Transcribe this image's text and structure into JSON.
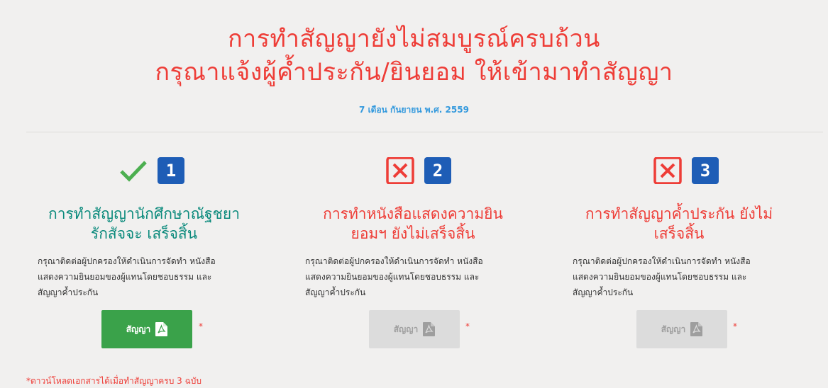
{
  "header": {
    "title_line1": "การทำสัญญายังไม่สมบูรณ์ครบถ้วน",
    "title_line2": "กรุณาแจ้งผู้ค้ำประกัน/ยินยอม ให้เข้ามาทำสัญญา",
    "date": "7 เดือน กันยายน พ.ศ. 2559"
  },
  "steps": [
    {
      "number": "1",
      "status": "complete",
      "status_icon": "check-icon",
      "heading_line1": "การทำสัญญานักศึกษาณัฐชยา",
      "heading_line2": "รักสัจจะ เสร็จสิ้น",
      "desc_line1": "กรุณาติดต่อผู้ปกครองให้ดำเนินการจัดทำ หนังสือ",
      "desc_line2": "แสดงความยินยอมของผู้แทนโดยชอบธรรม และ",
      "desc_line3": "สัญญาค้ำประกัน",
      "button_label": "สัญญา",
      "button_enabled": true,
      "asterisk": "*"
    },
    {
      "number": "2",
      "status": "incomplete",
      "status_icon": "x-box-icon",
      "heading_line1": "การทำหนังสือแสดงความยิน",
      "heading_line2": "ยอมฯ ยังไม่เสร็จสิ้น",
      "desc_line1": "กรุณาติดต่อผู้ปกครองให้ดำเนินการจัดทำ หนังสือ",
      "desc_line2": "แสดงความยินยอมของผู้แทนโดยชอบธรรม และ",
      "desc_line3": "สัญญาค้ำประกัน",
      "button_label": "สัญญา",
      "button_enabled": false,
      "asterisk": "*"
    },
    {
      "number": "3",
      "status": "incomplete",
      "status_icon": "x-box-icon",
      "heading_line1": "การทำสัญญาค้ำประกัน ยังไม่",
      "heading_line2": "เสร็จสิ้น",
      "desc_line1": "กรุณาติดต่อผู้ปกครองให้ดำเนินการจัดทำ หนังสือ",
      "desc_line2": "แสดงความยินยอมของผู้แทนโดยชอบธรรม และ",
      "desc_line3": "สัญญาค้ำประกัน",
      "button_label": "สัญญา",
      "button_enabled": false,
      "asterisk": "*"
    }
  ],
  "footnote": "*ดาวน์โหลดเอกสารได้เมื่อทำสัญญาครบ 3 ฉบับ",
  "colors": {
    "title_red": "#ee3d37",
    "date_blue": "#3399dd",
    "complete_teal": "#0b8a7c",
    "check_green": "#4caf50",
    "badge_blue": "#1e5db6",
    "button_green": "#3aa24a",
    "button_disabled": "#dcdcdc"
  }
}
